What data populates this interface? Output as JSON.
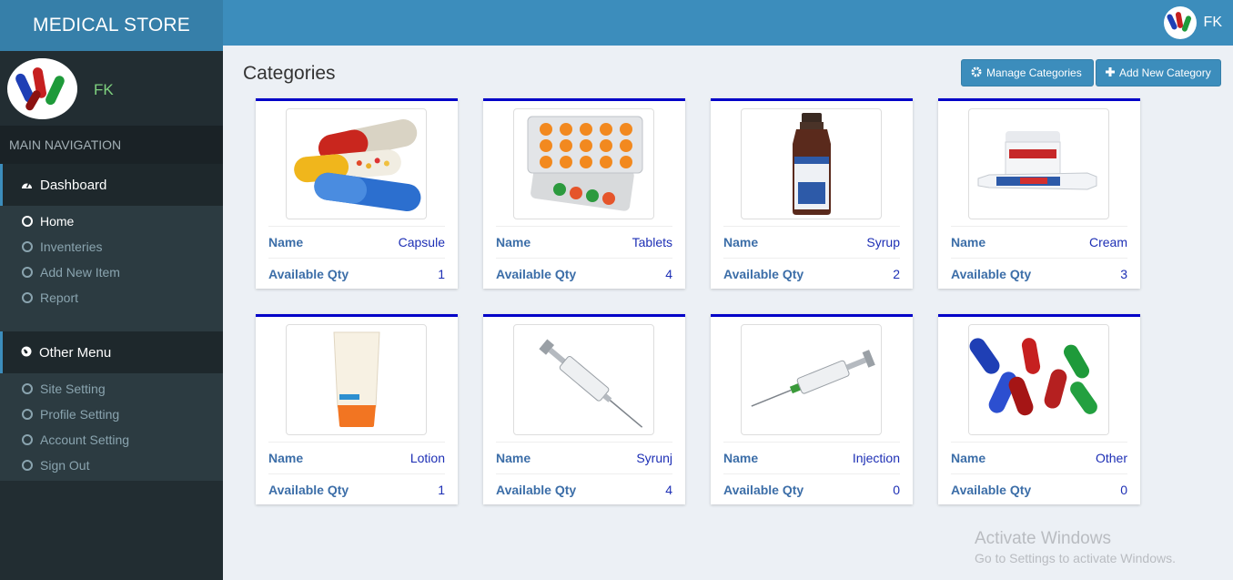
{
  "brand": "MEDICAL STORE",
  "header": {
    "user": "FK"
  },
  "sidebar": {
    "user": "FK",
    "nav_header": "MAIN NAVIGATION",
    "dashboard": {
      "label": "Dashboard",
      "items": [
        "Home",
        "Inventeries",
        "Add New Item",
        "Report"
      ]
    },
    "other": {
      "label": "Other Menu",
      "items": [
        "Site Setting",
        "Profile Setting",
        "Account Setting",
        "Sign Out"
      ]
    }
  },
  "page": {
    "title": "Categories",
    "manage_label": "Manage Categories",
    "add_label": "Add New Category"
  },
  "card_labels": {
    "name": "Name",
    "qty": "Available Qty"
  },
  "categories": [
    {
      "name": "Capsule",
      "qty": "1",
      "icon": "capsule-image"
    },
    {
      "name": "Tablets",
      "qty": "4",
      "icon": "tablets-image"
    },
    {
      "name": "Syrup",
      "qty": "2",
      "icon": "syrup-image"
    },
    {
      "name": "Cream",
      "qty": "3",
      "icon": "cream-image"
    },
    {
      "name": "Lotion",
      "qty": "1",
      "icon": "lotion-image"
    },
    {
      "name": "Syrunj",
      "qty": "4",
      "icon": "syringe-image"
    },
    {
      "name": "Injection",
      "qty": "0",
      "icon": "injection-image"
    },
    {
      "name": "Other",
      "qty": "0",
      "icon": "pills-image"
    }
  ],
  "watermark": {
    "line1": "Activate Windows",
    "line2": "Go to Settings to activate Windows."
  },
  "colors": {
    "topbar": "#3c8dbc",
    "sidebar": "#222d32",
    "card_border": "#0000c8"
  }
}
